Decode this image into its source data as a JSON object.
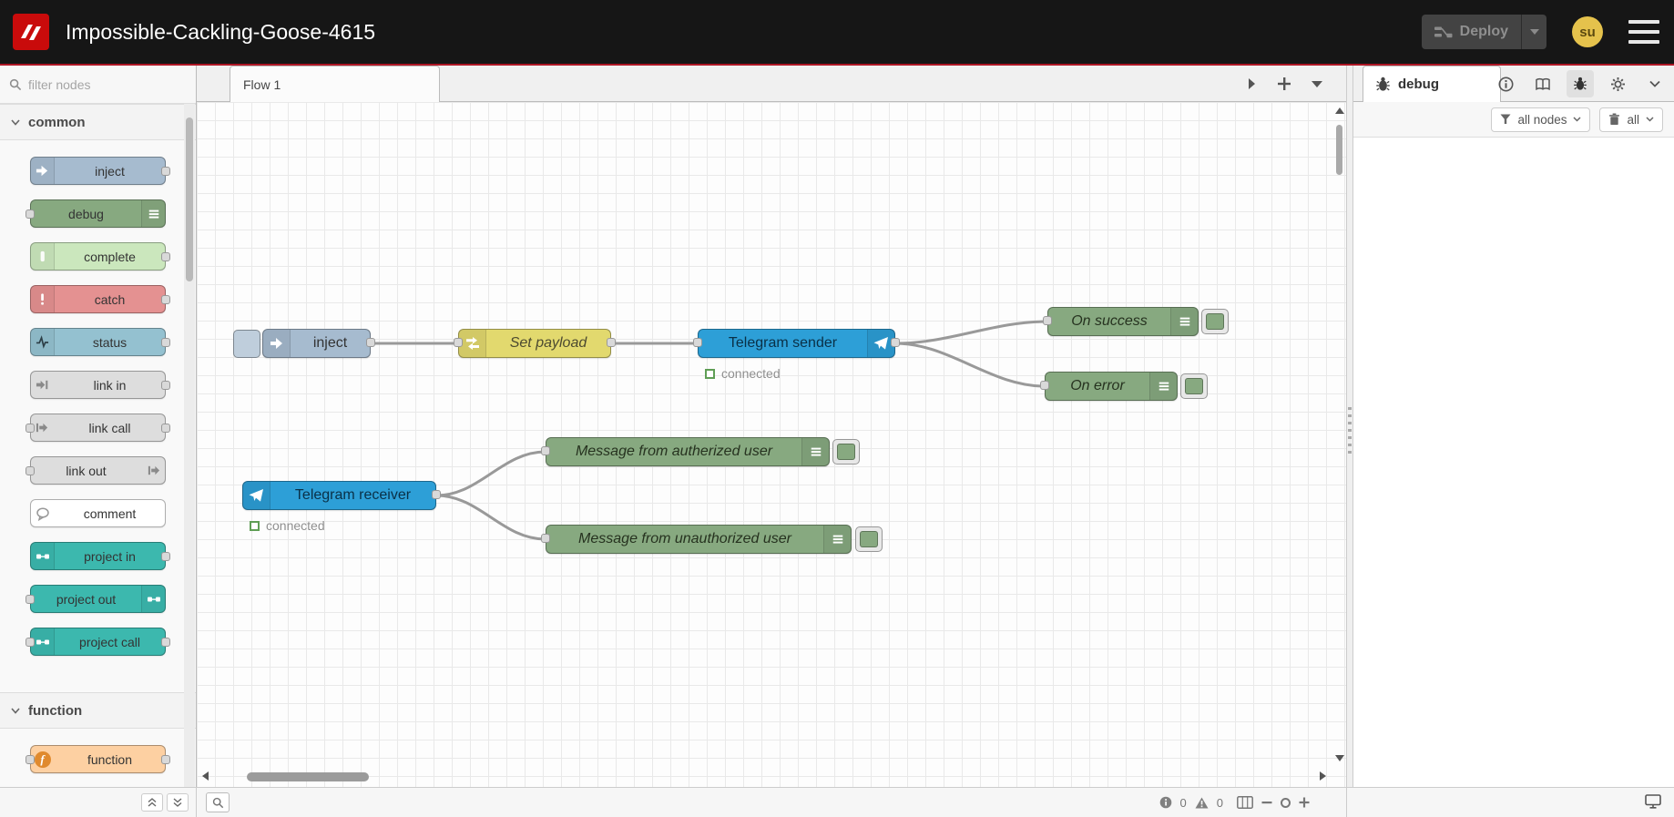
{
  "colors": {
    "accent_red": "#ad1625",
    "header_bg": "#161616",
    "node_inject": "#a6bbcf",
    "node_debug": "#87a980",
    "node_complete": "#cbe7bd",
    "node_catch": "#e49191",
    "node_status": "#94c1d0",
    "node_link": "#dddddd",
    "node_comment": "#ffffff",
    "node_project": "#3cb8ae",
    "node_function": "#fdd0a2",
    "node_change": "#e2d96e",
    "node_telegram": "#2d9fd7"
  },
  "header": {
    "title": "Impossible-Cackling-Goose-4615",
    "deploy_label": "Deploy",
    "user_initials": "su"
  },
  "palette": {
    "filter_placeholder": "filter nodes",
    "categories": [
      {
        "label": "common",
        "nodes": [
          {
            "label": "inject",
            "icon": "inject-arrow-icon"
          },
          {
            "label": "debug",
            "icon": "debug-lines-icon"
          },
          {
            "label": "complete",
            "icon": "complete-bar-icon"
          },
          {
            "label": "catch",
            "icon": "exclamation-icon"
          },
          {
            "label": "status",
            "icon": "pulse-icon"
          },
          {
            "label": "link in",
            "icon": "link-in-icon"
          },
          {
            "label": "link call",
            "icon": "link-call-icon"
          },
          {
            "label": "link out",
            "icon": "link-out-icon"
          },
          {
            "label": "comment",
            "icon": "comment-bubble-icon"
          },
          {
            "label": "project in",
            "icon": "project-icon"
          },
          {
            "label": "project out",
            "icon": "project-icon"
          },
          {
            "label": "project call",
            "icon": "project-icon"
          }
        ]
      },
      {
        "label": "function",
        "nodes": [
          {
            "label": "function",
            "icon": "function-f-icon"
          }
        ]
      }
    ]
  },
  "workspace": {
    "tab_label": "Flow 1",
    "nodes": {
      "inject": {
        "label": "inject"
      },
      "set_payload": {
        "label": "Set payload"
      },
      "telegram_sender": {
        "label": "Telegram sender",
        "status": "connected"
      },
      "on_success": {
        "label": "On success"
      },
      "on_error": {
        "label": "On error"
      },
      "telegram_receiver": {
        "label": "Telegram receiver",
        "status": "connected"
      },
      "msg_auth": {
        "label": "Message from autherized user"
      },
      "msg_unauth": {
        "label": "Message from unauthorized user"
      }
    },
    "footer": {
      "info_count": "0",
      "warning_count": "0"
    }
  },
  "sidebar": {
    "tab_label": "debug",
    "filter_button": "all nodes",
    "clear_button": "all"
  }
}
